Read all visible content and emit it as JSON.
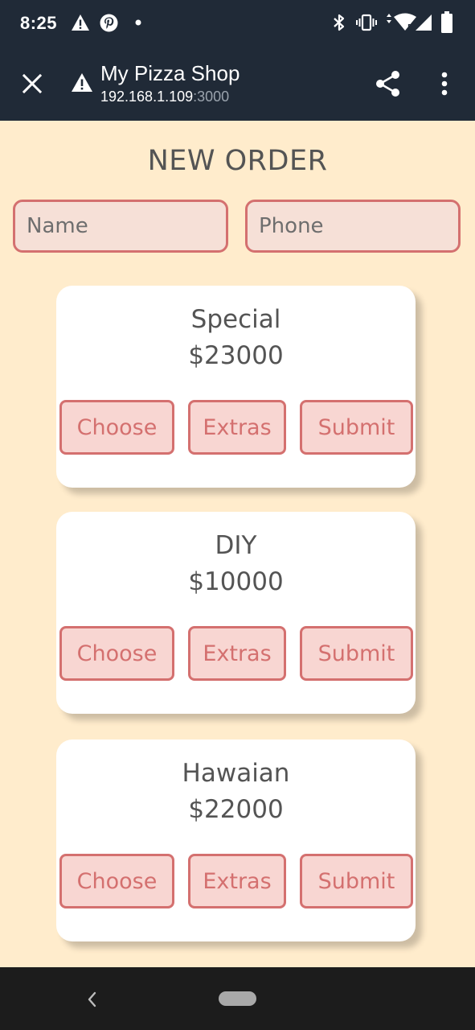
{
  "status_bar": {
    "time": "8:25",
    "icons": [
      "warning-icon",
      "pinterest-icon",
      "dot-icon",
      "bluetooth-icon",
      "vibrate-icon",
      "wifi-icon",
      "cell-signal-icon",
      "battery-icon"
    ]
  },
  "browser": {
    "title": "My Pizza Shop",
    "host": "192.168.1.109",
    "port": ":3000",
    "icons": [
      "close-icon",
      "warning-icon",
      "share-icon",
      "more-vert-icon"
    ]
  },
  "page": {
    "title": "NEW ORDER",
    "name_placeholder": "Name",
    "phone_placeholder": "Phone"
  },
  "pizzas": [
    {
      "name": "Special",
      "price": "$23000",
      "choose": "Choose",
      "extras": "Extras",
      "submit": "Submit"
    },
    {
      "name": "DIY",
      "price": "$10000",
      "choose": "Choose",
      "extras": "Extras",
      "submit": "Submit"
    },
    {
      "name": "Hawaian",
      "price": "$22000",
      "choose": "Choose",
      "extras": "Extras",
      "submit": "Submit"
    }
  ],
  "colors": {
    "background": "#ffeccc",
    "bar": "#202a37",
    "accent": "#d4706f",
    "button_fill": "#f8d6d2",
    "input_fill": "#f6e0d7",
    "text": "#545454"
  }
}
